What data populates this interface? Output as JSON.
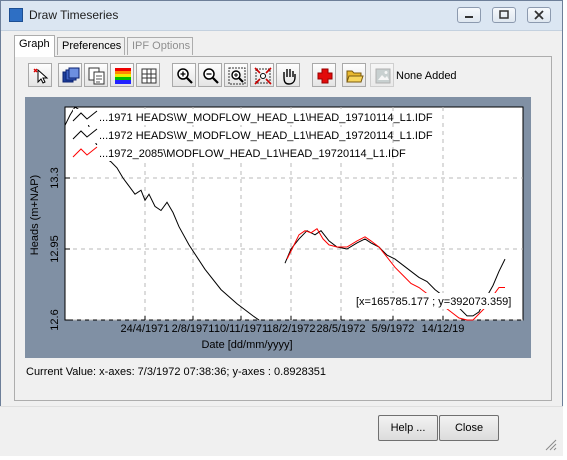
{
  "window": {
    "title": "Draw Timeseries"
  },
  "tabs": [
    {
      "label": "Graph",
      "active": true,
      "enabled": true
    },
    {
      "label": "Preferences",
      "active": false,
      "enabled": true
    },
    {
      "label": "IPF Options",
      "active": false,
      "enabled": false
    }
  ],
  "toolbar": {
    "icons": [
      "select-pointer-icon",
      "layers-icon",
      "copy-icon",
      "color-legend-icon",
      "table-grid-icon",
      "zoom-in-icon",
      "zoom-out-icon",
      "zoom-window-icon",
      "zoom-extent-icon",
      "pan-hand-icon",
      "add-icon",
      "open-folder-icon",
      "disabled-image-icon"
    ],
    "status_text": "None Added"
  },
  "chart_data": {
    "type": "line",
    "ylabel": "Heads (m+NAP)",
    "xlabel": "Date [dd/mm/yyyy]",
    "x_ticks": [
      "24/4/1971",
      "2/8/1971",
      "10/11/1971",
      "18/2/1972",
      "28/5/1972",
      "5/9/1972",
      "14/12/19"
    ],
    "y_ticks": [
      "12.6",
      "12.95",
      "13.3"
    ],
    "ylim": [
      12.6,
      13.65
    ],
    "grid": true,
    "legend_placement": "top-left",
    "cursor_readout": "[x=165785.177 ; y=392073.359]",
    "series": [
      {
        "name": "...1971 HEADS\\W_MODFLOW_HEAD_L1\\HEAD_19710114_L1.IDF",
        "color": "#000000",
        "points": [
          [
            0,
            13.56
          ],
          [
            5,
            13.61
          ],
          [
            10,
            13.65
          ],
          [
            16,
            13.63
          ],
          [
            22,
            13.58
          ],
          [
            28,
            13.5
          ],
          [
            34,
            13.44
          ],
          [
            40,
            13.4
          ],
          [
            46,
            13.38
          ],
          [
            52,
            13.35
          ],
          [
            58,
            13.3
          ],
          [
            64,
            13.26
          ],
          [
            70,
            13.22
          ],
          [
            76,
            13.24
          ],
          [
            80,
            13.19
          ],
          [
            84,
            13.22
          ],
          [
            90,
            13.16
          ],
          [
            96,
            13.14
          ],
          [
            102,
            13.18
          ],
          [
            108,
            13.13
          ],
          [
            114,
            13.06
          ],
          [
            124,
            12.97
          ],
          [
            140,
            12.85
          ],
          [
            156,
            12.75
          ],
          [
            172,
            12.68
          ],
          [
            188,
            12.62
          ],
          [
            194,
            12.6
          ]
        ]
      },
      {
        "name": "...1972 HEADS\\W_MODFLOW_HEAD_L1\\HEAD_19720114_L1.IDF",
        "color": "#000000",
        "points": [
          [
            220,
            12.88
          ],
          [
            226,
            12.95
          ],
          [
            234,
            13.0
          ],
          [
            242,
            13.04
          ],
          [
            250,
            13.02
          ],
          [
            256,
            13.04
          ],
          [
            264,
            12.99
          ],
          [
            272,
            12.96
          ],
          [
            282,
            12.95
          ],
          [
            292,
            12.98
          ],
          [
            300,
            13.0
          ],
          [
            306,
            12.98
          ],
          [
            314,
            12.96
          ],
          [
            322,
            12.92
          ],
          [
            330,
            12.9
          ],
          [
            338,
            12.87
          ],
          [
            346,
            12.84
          ],
          [
            354,
            12.81
          ],
          [
            362,
            12.79
          ],
          [
            370,
            12.75
          ],
          [
            378,
            12.72
          ],
          [
            386,
            12.67
          ],
          [
            394,
            12.66
          ],
          [
            402,
            12.62
          ],
          [
            408,
            12.62
          ],
          [
            414,
            12.64
          ],
          [
            420,
            12.7
          ],
          [
            428,
            12.77
          ],
          [
            434,
            12.84
          ],
          [
            440,
            12.9
          ]
        ]
      },
      {
        "name": "...1972_2085\\MODFLOW_HEAD_L1\\HEAD_19720114_L1.IDF",
        "color": "#ff0000",
        "points": [
          [
            222,
            12.9
          ],
          [
            228,
            12.96
          ],
          [
            234,
            13.02
          ],
          [
            240,
            13.04
          ],
          [
            246,
            13.03
          ],
          [
            252,
            13.05
          ],
          [
            258,
            13.0
          ],
          [
            264,
            12.97
          ],
          [
            272,
            12.96
          ],
          [
            282,
            12.96
          ],
          [
            292,
            12.99
          ],
          [
            300,
            13.01
          ],
          [
            306,
            12.99
          ],
          [
            314,
            12.96
          ],
          [
            322,
            12.91
          ],
          [
            330,
            12.86
          ],
          [
            338,
            12.82
          ],
          [
            346,
            12.78
          ],
          [
            354,
            12.76
          ],
          [
            362,
            12.73
          ],
          [
            370,
            12.7
          ],
          [
            378,
            12.67
          ],
          [
            386,
            12.64
          ],
          [
            394,
            12.61
          ],
          [
            402,
            12.6
          ],
          [
            408,
            12.6
          ],
          [
            414,
            12.63
          ],
          [
            420,
            12.66
          ],
          [
            428,
            12.72
          ],
          [
            434,
            12.76
          ],
          [
            440,
            12.76
          ]
        ]
      }
    ]
  },
  "status_bar": {
    "current_value": "Current Value: x-axes: 7/3/1972 07:38:36; y-axes : 0.8928351"
  },
  "footer": {
    "help_label": "Help ...",
    "close_label": "Close"
  }
}
